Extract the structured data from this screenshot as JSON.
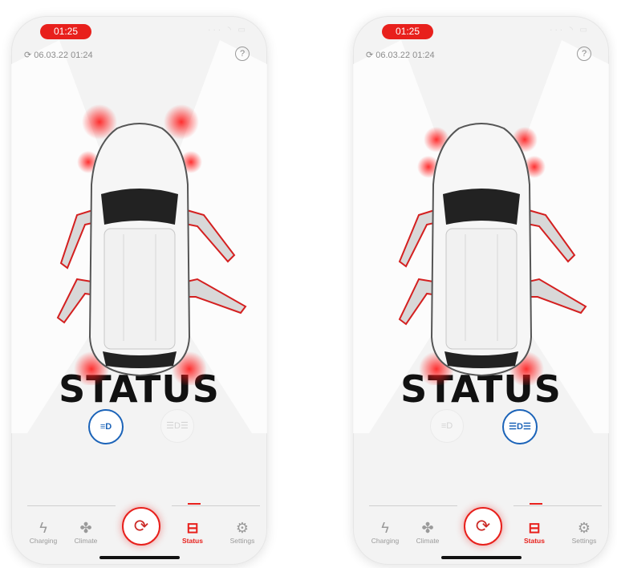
{
  "screens": [
    {
      "time": "01:25",
      "last_sync": "06.03.22 01:24",
      "help_label": "?",
      "title": "STATUS",
      "lights": {
        "low_beam": "≡D",
        "parking": "☰D☰",
        "active": "low_beam"
      },
      "tabs": [
        {
          "label": "Charging",
          "icon": "bolt-icon"
        },
        {
          "label": "Climate",
          "icon": "fan-icon"
        },
        {
          "label": "Status",
          "icon": "car-door-icon",
          "active": true
        },
        {
          "label": "Settings",
          "icon": "gear-icon"
        }
      ]
    },
    {
      "time": "01:25",
      "last_sync": "06.03.22 01:24",
      "help_label": "?",
      "title": "STATUS",
      "lights": {
        "low_beam": "≡D",
        "parking": "☰D☰",
        "active": "parking"
      },
      "tabs": [
        {
          "label": "Charging",
          "icon": "bolt-icon"
        },
        {
          "label": "Climate",
          "icon": "fan-icon"
        },
        {
          "label": "Status",
          "icon": "car-door-icon",
          "active": true
        },
        {
          "label": "Settings",
          "icon": "gear-icon"
        }
      ]
    }
  ],
  "icons": {
    "sync": "⟳",
    "refresh": "⟳",
    "bolt": "ϟ",
    "fan": "✤",
    "door": "⊟",
    "gear": "⚙",
    "status_bar": "··· ◝ ▭"
  },
  "colors": {
    "accent": "#e8201c",
    "active_light": "#1b63b8",
    "background": "#f3f3f3"
  }
}
